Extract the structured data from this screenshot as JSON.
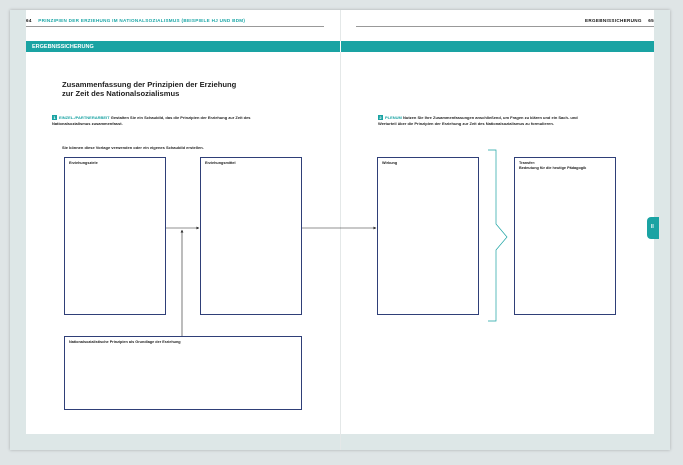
{
  "header": {
    "left_page_number": "64",
    "left_title": "PRINZIPIEN DER ERZIEHUNG IM NATIONALSOZIALISMUS (BEISPIELE HJ UND BDM)",
    "right_title": "ERGEBNISSICHERUNG",
    "right_page_number": "65"
  },
  "section_bar": {
    "label": "ERGEBNISSICHERUNG"
  },
  "side_tab": {
    "label": "II"
  },
  "title": {
    "line1": "Zusammenfassung der Prinzipien der Erziehung",
    "line2": "zur Zeit des Nationalsozialismus"
  },
  "task1": {
    "number": "1",
    "keyword": "EINZEL-/PARTNERARBEIT",
    "text": "Gestalten Sie ein Schaubild, das die Prinzipien der Erziehung zur Zeit des Nationalsozialismus zusammenfasst."
  },
  "task1_note": "Sie können diese Vorlage verwenden oder ein eigenes Schaubild erstellen.",
  "task2": {
    "number": "2",
    "keyword": "PLENUM",
    "text": "Nutzen Sie Ihre Zusammenfassungen anschließend, um Fragen zu klären und ein Sach- und Werturteil über die Prinzipien der Erziehung zur Zeit des Nationalsozialismus zu formulieren."
  },
  "boxes": {
    "erziehungsziele": "Erziehungsziele",
    "erziehungsmittel": "Erziehungsmittel",
    "grundlage": "Nationalsozialistische Prinzipien als Grundlage der Erziehung",
    "wirkung": "Wirkung",
    "transfer_line1": "Transfer:",
    "transfer_line2": "Bedeutung für die heutige Pädagogik"
  },
  "colors": {
    "accent": "#1aa3a3",
    "box_border": "#2f3f78"
  }
}
